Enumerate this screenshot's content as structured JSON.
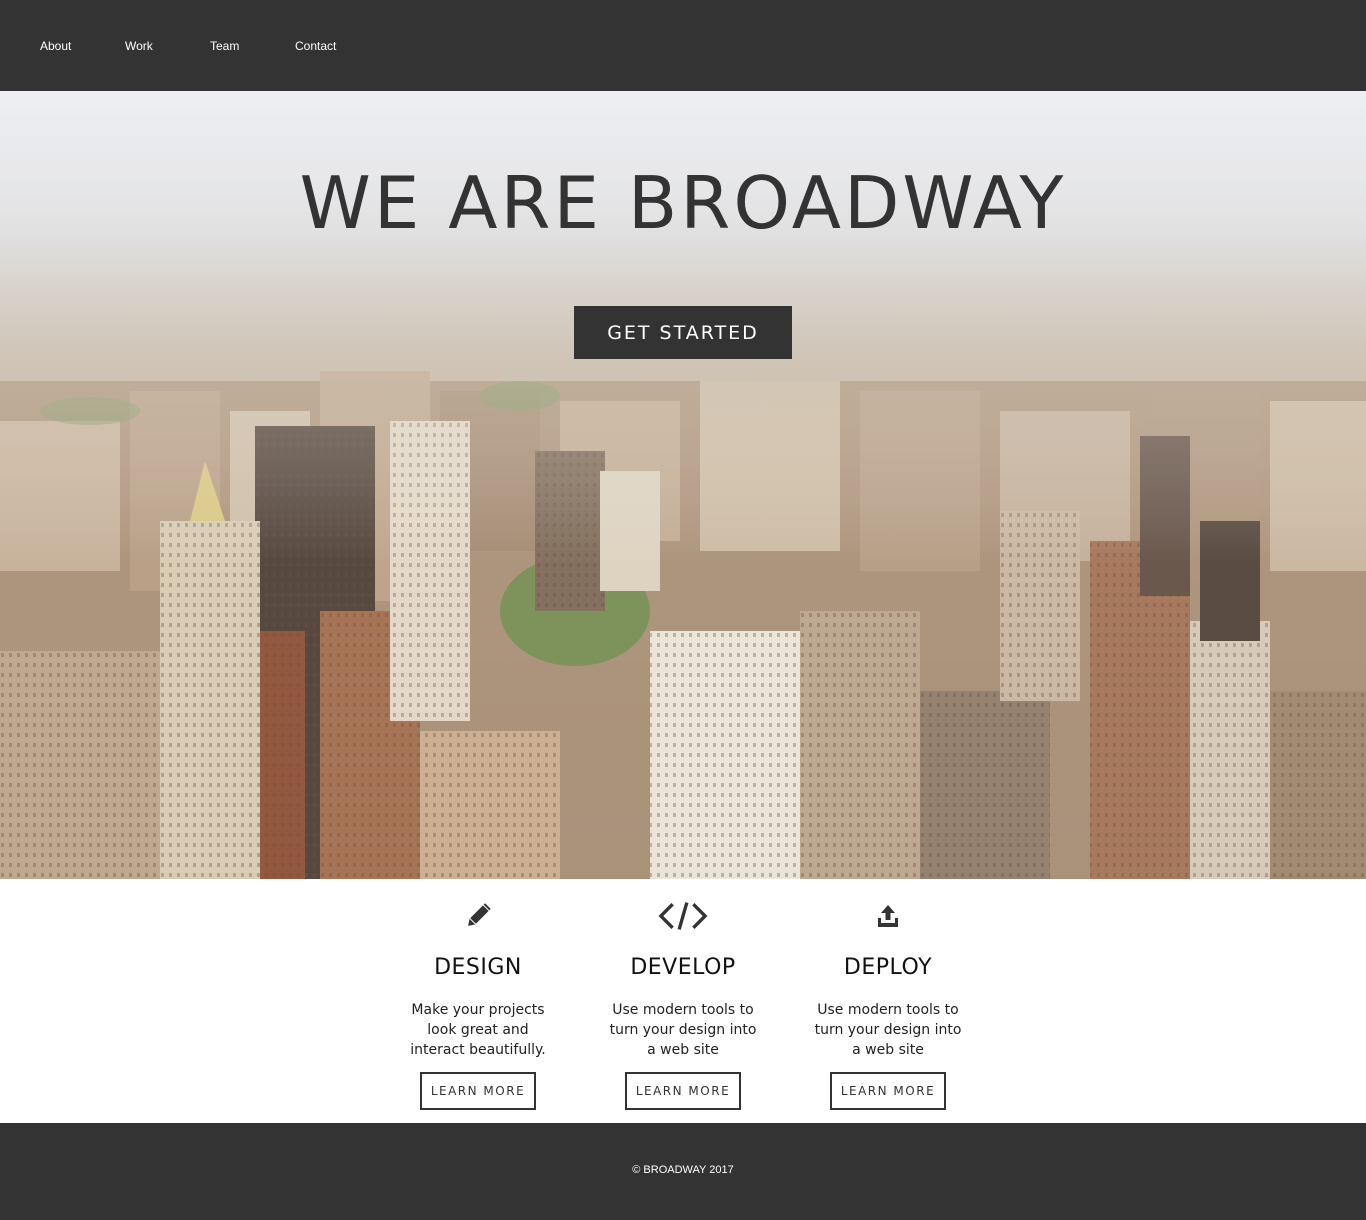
{
  "nav": {
    "items": [
      {
        "label": "About"
      },
      {
        "label": "Work"
      },
      {
        "label": "Team"
      },
      {
        "label": "Contact"
      }
    ]
  },
  "hero": {
    "title": "WE ARE BROADWAY",
    "cta_label": "GET STARTED",
    "background": "aerial-city-photo"
  },
  "features": [
    {
      "icon": "pencil-icon",
      "title": "DESIGN",
      "description": "Make your projects look great and interact beautifully.",
      "button": "LEARN MORE"
    },
    {
      "icon": "code-icon",
      "title": "DEVELOP",
      "description": "Use modern tools to turn your design into a web site",
      "button": "LEARN MORE"
    },
    {
      "icon": "upload-icon",
      "title": "DEPLOY",
      "description": "Use modern tools to turn your design into a web site",
      "button": "LEARN MORE"
    }
  ],
  "footer": {
    "copyright": "© BROADWAY 2017"
  },
  "colors": {
    "dark": "#333333",
    "white": "#ffffff"
  }
}
